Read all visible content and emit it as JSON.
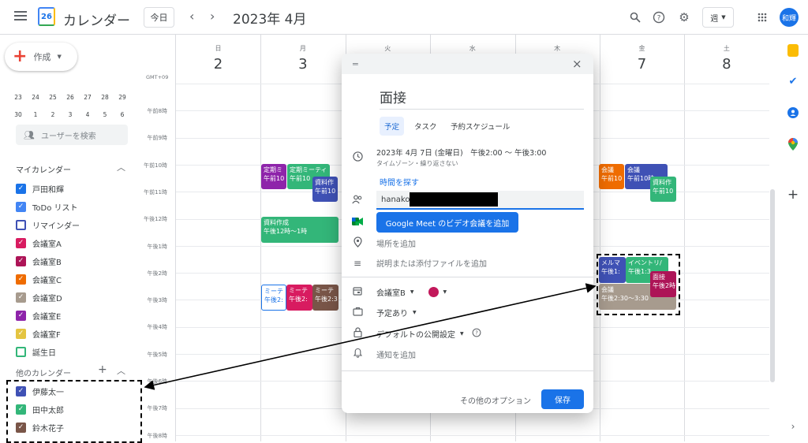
{
  "header": {
    "app_name": "カレンダー",
    "logo_day": "26",
    "today_label": "今日",
    "date_title": "2023年 4月",
    "view_label": "週",
    "avatar_text": "和輝"
  },
  "sidebar": {
    "create_label": "作成",
    "mini_calendar": [
      [
        "23",
        "24",
        "25",
        "26",
        "27",
        "28",
        "29"
      ],
      [
        "30",
        "1",
        "2",
        "3",
        "4",
        "5",
        "6"
      ]
    ],
    "search_placeholder": "ユーザーを検索",
    "my_calendars_title": "マイカレンダー",
    "my_calendars": [
      {
        "label": "戸田和輝",
        "color": "#1a73e8",
        "checked": true
      },
      {
        "label": "ToDo リスト",
        "color": "#4285f4",
        "checked": true
      },
      {
        "label": "リマインダー",
        "color": "#3f51b5",
        "checked": false
      },
      {
        "label": "会議室A",
        "color": "#d81b60",
        "checked": true
      },
      {
        "label": "会議室B",
        "color": "#ad1457",
        "checked": true
      },
      {
        "label": "会議室C",
        "color": "#ef6c00",
        "checked": true
      },
      {
        "label": "会議室D",
        "color": "#a79b8e",
        "checked": true
      },
      {
        "label": "会議室E",
        "color": "#8e24aa",
        "checked": true
      },
      {
        "label": "会議室F",
        "color": "#e4c441",
        "checked": true
      },
      {
        "label": "誕生日",
        "color": "#33b679",
        "checked": false
      }
    ],
    "other_calendars_title": "他のカレンダー",
    "other_calendars": [
      {
        "label": "伊藤太一",
        "color": "#3f51b5",
        "checked": true
      },
      {
        "label": "田中太郎",
        "color": "#33b679",
        "checked": true
      },
      {
        "label": "鈴木花子",
        "color": "#795548",
        "checked": true
      }
    ]
  },
  "grid": {
    "timezone": "GMT+09",
    "days": [
      {
        "dow": "日",
        "num": "2"
      },
      {
        "dow": "月",
        "num": "3"
      },
      {
        "dow": "火",
        "num": ""
      },
      {
        "dow": "水",
        "num": ""
      },
      {
        "dow": "木",
        "num": ""
      },
      {
        "dow": "金",
        "num": "7"
      },
      {
        "dow": "土",
        "num": "8"
      }
    ],
    "times": [
      "午前8時",
      "午前9時",
      "午前10時",
      "午前11時",
      "午後12時",
      "午後1時",
      "午後2時",
      "午後3時",
      "午後4時",
      "午後5時",
      "午後6時",
      "午後7時",
      "午後8時"
    ],
    "events": {
      "e1_title": "定期ミ",
      "e1_time": "午前10",
      "e2_title": "定期ミーティ",
      "e2_time": "午前10",
      "e3_title": "資料作",
      "e3_time": "午前10",
      "e4_title": "資料作成",
      "e4_time": "午後12時〜1時",
      "e5_title": "ミーテ",
      "e5_time": "午後2:",
      "e6_title": "ミーテ",
      "e6_time": "午後2:",
      "e7_title": "ミーテ",
      "e7_time": "午後2:3",
      "e8_title": "会議",
      "e8_time": "午前10",
      "e9_title": "会議",
      "e9_time": "午前10時",
      "e10_title": "資料作",
      "e10_time": "午前10",
      "e11_title": "メルマ",
      "e11_time": "午後1:",
      "e12_title": "イベントリ/",
      "e12_time": "午後1:3",
      "e13_title": "面接",
      "e13_time": "午後2時",
      "e14_title": "会議",
      "e14_time": "午後2:30〜3:30"
    }
  },
  "dialog": {
    "title": "面接",
    "tabs": [
      "予定",
      "タスク",
      "予約スケジュール"
    ],
    "datetime": "2023年 4月 7日 (金曜日)　午後2:00 〜 午後3:00",
    "recurrence": "タイムゾーン・繰り返さない",
    "find_time": "時間を探す",
    "guest_value": "hanako",
    "meet_button": "Google Meet のビデオ会議を追加",
    "location_placeholder": "場所を追加",
    "description_placeholder": "説明または添付ファイルを追加",
    "calendar_select": "会議室B",
    "busy_select": "予定あり",
    "visibility_select": "デフォルトの公開設定",
    "notification": "通知を追加",
    "more_options": "その他のオプション",
    "save_label": "保存",
    "event_color": "#c2185b"
  }
}
